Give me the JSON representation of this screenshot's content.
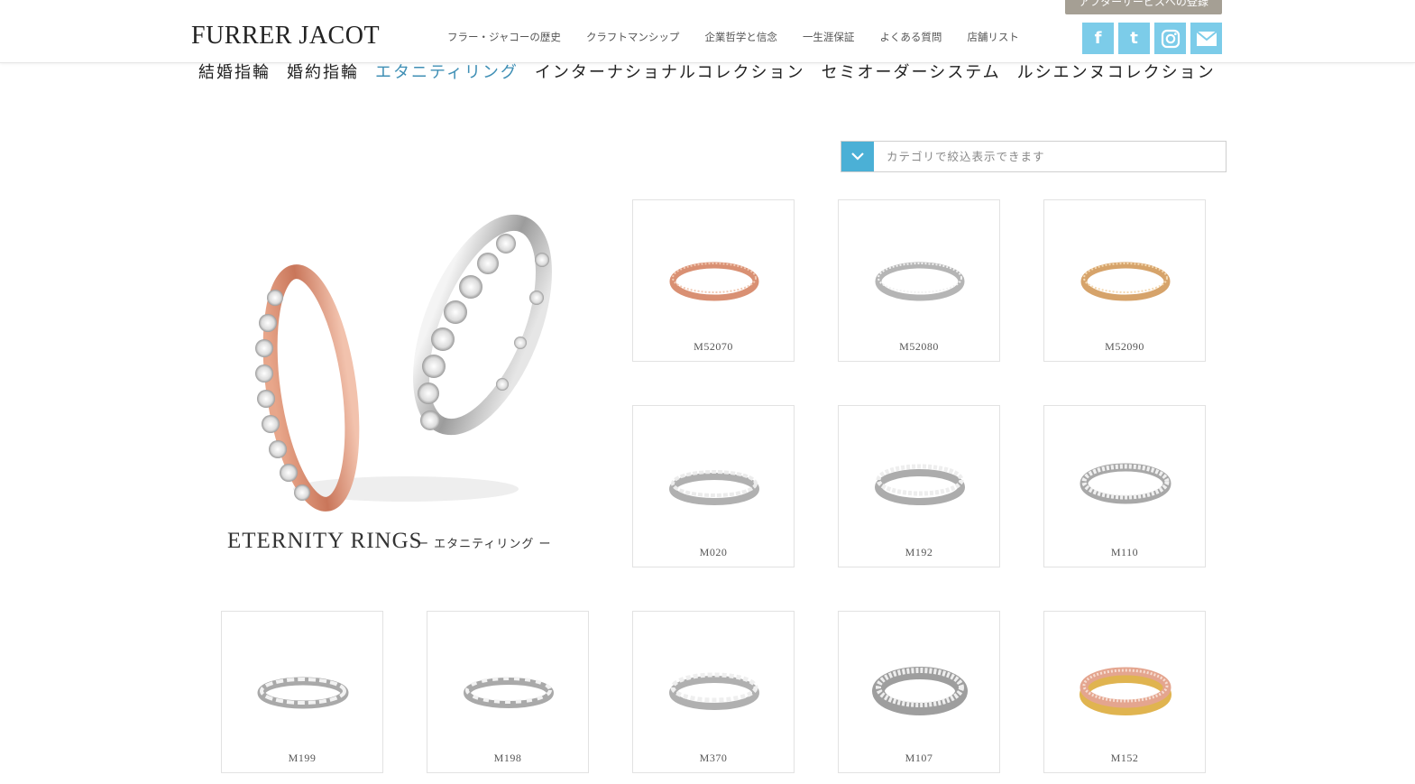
{
  "header": {
    "logo": "FURRER JACOT",
    "after_service_label": "アフターサービスへの登録",
    "nav": [
      "フラー・ジャコーの歴史",
      "クラフトマンシップ",
      "企業哲学と信念",
      "一生涯保証",
      "よくある質問",
      "店舗リスト"
    ],
    "social": [
      {
        "icon": "facebook-icon",
        "glyph": "f"
      },
      {
        "icon": "twitter-icon",
        "glyph": "t"
      },
      {
        "icon": "instagram-icon",
        "glyph": ""
      },
      {
        "icon": "mail-icon",
        "glyph": ""
      }
    ]
  },
  "categories": [
    {
      "label": "結婚指輪",
      "active": false
    },
    {
      "label": "婚約指輪",
      "active": false
    },
    {
      "label": "エタニティリング",
      "active": true
    },
    {
      "label": "インターナショナルコレクション",
      "active": false
    },
    {
      "label": "セミオーダーシステム",
      "active": false
    },
    {
      "label": "ルシエンヌコレクション",
      "active": false
    }
  ],
  "filter": {
    "placeholder": "カテゴリで絞込表示できます"
  },
  "hero": {
    "title": "ETERNITY RINGS",
    "subtitle": "ー エタニティリング ー"
  },
  "products": [
    {
      "code": "M52070",
      "metal": "rose"
    },
    {
      "code": "M52080",
      "metal": "white"
    },
    {
      "code": "M52090",
      "metal": "yellow"
    },
    {
      "code": "M020",
      "metal": "white"
    },
    {
      "code": "M192",
      "metal": "white"
    },
    {
      "code": "M110",
      "metal": "white"
    },
    {
      "code": "M199",
      "metal": "white"
    },
    {
      "code": "M198",
      "metal": "white"
    },
    {
      "code": "M370",
      "metal": "white"
    },
    {
      "code": "M107",
      "metal": "white"
    },
    {
      "code": "M152",
      "metal": "rose-yellow"
    }
  ],
  "colors": {
    "accent": "#4bb0d6",
    "active_category": "#3f8fb5",
    "social": "#7ccce9",
    "after_tab": "#a59f94"
  }
}
